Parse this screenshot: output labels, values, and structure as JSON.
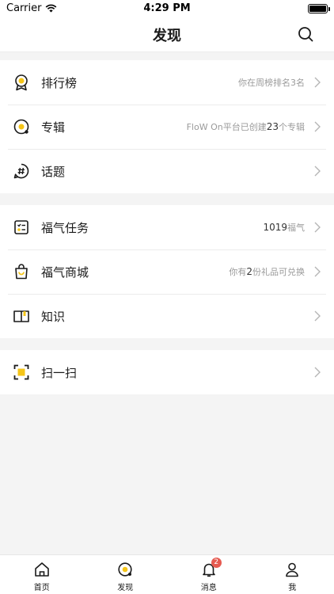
{
  "status_bar": {
    "carrier": "Carrier",
    "time": "4:29 PM"
  },
  "nav": {
    "title": "发现"
  },
  "groups": [
    {
      "rows": [
        {
          "label": "排行榜",
          "detail_pre": "你在周榜排名3名",
          "detail_num": "",
          "detail_post": "",
          "icon": "medal-icon"
        },
        {
          "label": "专辑",
          "detail_pre": "FloW On平台已创建",
          "detail_num": "23",
          "detail_post": "个专辑",
          "icon": "album-icon"
        },
        {
          "label": "话题",
          "detail_pre": "",
          "detail_num": "",
          "detail_post": "",
          "icon": "hashtag-icon"
        }
      ]
    },
    {
      "rows": [
        {
          "label": "福气任务",
          "detail_pre": "",
          "detail_num": "1019",
          "detail_post": "福气",
          "icon": "task-list-icon"
        },
        {
          "label": "福气商城",
          "detail_pre": "你有",
          "detail_num": "2",
          "detail_post": "份礼品可兑换",
          "icon": "shopping-bag-icon"
        },
        {
          "label": "知识",
          "detail_pre": "",
          "detail_num": "",
          "detail_post": "",
          "icon": "book-icon"
        }
      ]
    },
    {
      "rows": [
        {
          "label": "扫一扫",
          "detail_pre": "",
          "detail_num": "",
          "detail_post": "",
          "icon": "scan-icon"
        }
      ]
    }
  ],
  "tabbar": {
    "tabs": [
      {
        "label": "首页",
        "icon": "home-icon"
      },
      {
        "label": "发现",
        "icon": "discover-icon"
      },
      {
        "label": "消息",
        "icon": "bell-icon",
        "badge": "2"
      },
      {
        "label": "我",
        "icon": "person-icon"
      }
    ]
  },
  "colors": {
    "accent": "#f5c518",
    "badge": "#e65a50",
    "text": "#1a1a1a",
    "muted": "#9a9a9a"
  }
}
